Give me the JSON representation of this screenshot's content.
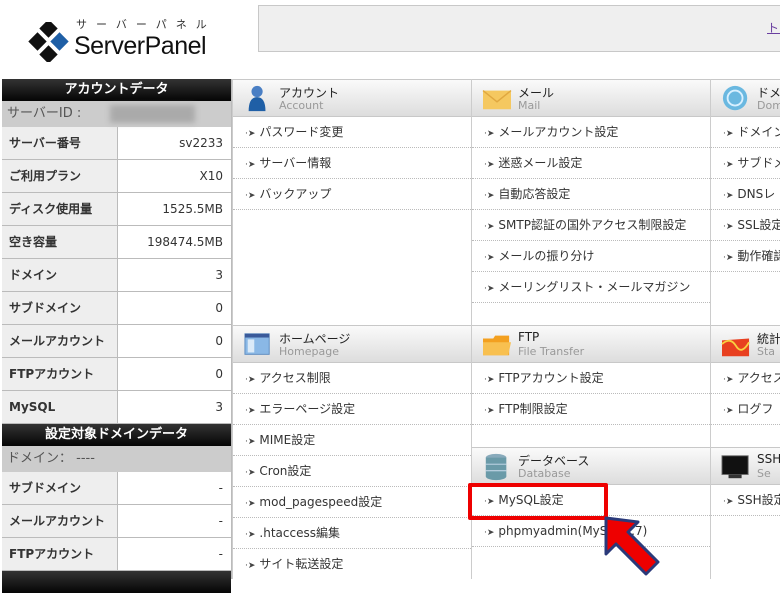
{
  "logo": {
    "kana": "サーバーパネル",
    "name": "ServerPanel"
  },
  "topbar": {
    "link": "トップ"
  },
  "account_data": {
    "title": "アカウントデータ",
    "server_id_label": "サーバーID :",
    "rows": [
      {
        "label": "サーバー番号",
        "value": "sv2233"
      },
      {
        "label": "ご利用プラン",
        "value": "X10"
      },
      {
        "label": "ディスク使用量",
        "value": "1525.5MB"
      },
      {
        "label": "空き容量",
        "value": "198474.5MB"
      },
      {
        "label": "ドメイン",
        "value": "3"
      },
      {
        "label": "サブドメイン",
        "value": "0"
      },
      {
        "label": "メールアカウント",
        "value": "0"
      },
      {
        "label": "FTPアカウント",
        "value": "0"
      },
      {
        "label": "MySQL",
        "value": "3"
      }
    ]
  },
  "domain_data": {
    "title": "設定対象ドメインデータ",
    "domain_label": "ドメイン： ----",
    "rows": [
      {
        "label": "サブドメイン",
        "value": "-"
      },
      {
        "label": "メールアカウント",
        "value": "-"
      },
      {
        "label": "FTPアカウント",
        "value": "-"
      }
    ]
  },
  "columns": [
    {
      "sections": [
        {
          "id": "account",
          "icon": "user-icon",
          "title": "アカウント",
          "subtitle": "Account",
          "items": [
            "パスワード変更",
            "サーバー情報",
            "バックアップ"
          ]
        },
        {
          "id": "homepage",
          "icon": "browser-window-icon",
          "title": "ホームページ",
          "subtitle": "Homepage",
          "items": [
            "アクセス制限",
            "エラーページ設定",
            "MIME設定",
            "Cron設定",
            "mod_pagespeed設定",
            ".htaccess編集",
            "サイト転送設定"
          ]
        }
      ]
    },
    {
      "sections": [
        {
          "id": "mail",
          "icon": "envelope-icon",
          "title": "メール",
          "subtitle": "Mail",
          "items": [
            "メールアカウント設定",
            "迷惑メール設定",
            "自動応答設定",
            "SMTP認証の国外アクセス制限設定",
            "メールの振り分け",
            "メーリングリスト・メールマガジン"
          ]
        },
        {
          "id": "ftp",
          "icon": "folder-icon",
          "title": "FTP",
          "subtitle": "File Transfer",
          "items": [
            "FTPアカウント設定",
            "FTP制限設定"
          ]
        },
        {
          "id": "database",
          "icon": "database-icon",
          "title": "データベース",
          "subtitle": "Database",
          "items": [
            "MySQL設定",
            "phpmyadmin(MySQL5.7)"
          ]
        }
      ]
    },
    {
      "sections": [
        {
          "id": "domain",
          "icon": "globe-icon",
          "title": "ドメイン",
          "subtitle": "Domain",
          "items": [
            "ドメイン",
            "サブドメ",
            "DNSレ",
            "SSL設定",
            "動作確認"
          ]
        },
        {
          "id": "stats",
          "icon": "stats-chart-icon",
          "title": "統計",
          "subtitle": "Sta",
          "items": [
            "アクセス",
            "ログフ"
          ]
        },
        {
          "id": "ssh",
          "icon": "monitor-icon",
          "title": "SSH",
          "subtitle": "Se",
          "items": [
            "SSH設定"
          ]
        }
      ]
    }
  ],
  "highlight": {
    "target": "MySQL設定",
    "color": "#e00000"
  },
  "colors": {
    "header_dark": "#111111",
    "highlight": "#e00000",
    "arrow_outline": "#2a3a7a"
  }
}
